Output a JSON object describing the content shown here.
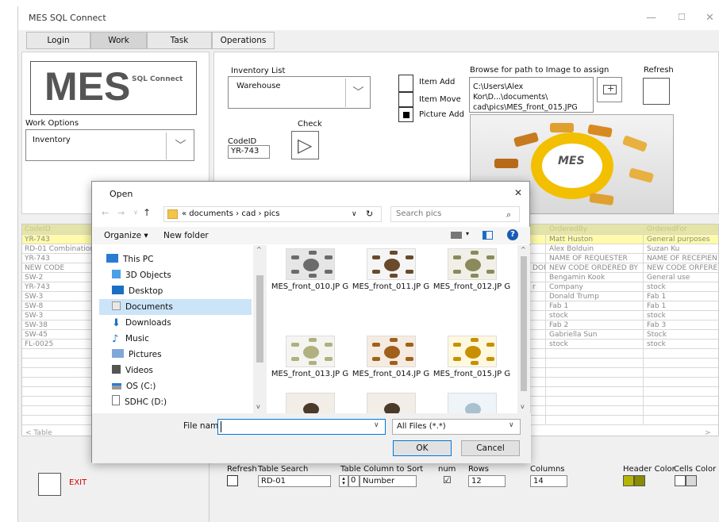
{
  "app": {
    "title": "MES SQL Connect",
    "minimize": "—",
    "maximize": "☐",
    "close": "✕"
  },
  "tabs": [
    {
      "label": "Login"
    },
    {
      "label": "Work"
    },
    {
      "label": "Task"
    },
    {
      "label": "Operations"
    }
  ],
  "logo": {
    "big": "MES",
    "small": "SQL Connect"
  },
  "work_options": {
    "label": "Work Options",
    "value": "Inventory"
  },
  "inventory": {
    "label": "Inventory List",
    "value": "Warehouse",
    "item_add": "Item Add",
    "item_move": "Item Move",
    "picture_add": "Picture Add",
    "check": "Check",
    "codeid_label": "CodeID",
    "codeid_value": "YR-743"
  },
  "browse": {
    "label": "Browse for path to Image to assign",
    "path": "C:\\Users\\Alex Kor\\D...\\documents\\ cad\\pics\\MES_front_015.JPG",
    "refresh": "Refresh",
    "image_center": "MES"
  },
  "grid": {
    "headers": [
      "CodeID",
      "OrderedBy",
      "OrderedFor"
    ],
    "rows": [
      {
        "code": "YR-743",
        "mid": "",
        "by": "Matt Huston",
        "for": "General purposes"
      },
      {
        "code": "RD-01 Combination",
        "mid": "",
        "by": "Alex Bolduin",
        "for": "Suzan Ku"
      },
      {
        "code": "YR-743",
        "mid": "",
        "by": "NAME OF REQUESTER",
        "for": "NAME OF RECEPIEN"
      },
      {
        "code": "NEW CODE",
        "mid": "DOR",
        "by": "NEW CODE ORDERED BY",
        "for": "NEW CODE ORFERE"
      },
      {
        "code": "SW-2",
        "mid": "",
        "by": "Bengamin Kook",
        "for": "General use"
      },
      {
        "code": "YR-743",
        "mid": "r",
        "by": "Company",
        "for": "stock"
      },
      {
        "code": "SW-3",
        "mid": "",
        "by": "Donald Trump",
        "for": "Fab 1"
      },
      {
        "code": "SW-8",
        "mid": "",
        "by": "Fab 1",
        "for": "Fab 1"
      },
      {
        "code": "SW-3",
        "mid": "",
        "by": "stock",
        "for": "stock"
      },
      {
        "code": "SW-38",
        "mid": "",
        "by": "Fab 2",
        "for": "Fab 3"
      },
      {
        "code": "SW-45",
        "mid": "",
        "by": "Gabriella Sun",
        "for": "Stock"
      },
      {
        "code": "FL-0025",
        "mid": "",
        "by": "stock",
        "for": "stock"
      }
    ],
    "caption": "Table",
    "scroll_left": "<",
    "scroll_right": ">"
  },
  "bottom": {
    "exit": "EXIT",
    "refresh": "Refresh",
    "table_search_label": "Table Search",
    "table_search_value": "RD-01",
    "sort_label": "Table Column to Sort",
    "sort_index": "0",
    "sort_value": "Number",
    "num_label": "num",
    "num_checked": "☑",
    "rows_label": "Rows",
    "rows_value": "12",
    "columns_label": "Columns",
    "columns_value": "14",
    "header_color_label": "Header Color",
    "cells_color_label": "Cells Color",
    "header_color": "#b5b500",
    "cells_color": "#d8d8d8"
  },
  "dialog": {
    "title": "Open",
    "close": "✕",
    "nav_back": "←",
    "nav_forward": "→",
    "nav_recent": "∨",
    "nav_up": "↑",
    "path": "« documents › cad › pics",
    "path_dropdown": "∨",
    "refresh": "↻",
    "search_placeholder": "Search pics",
    "organize": "Organize ▾",
    "new_folder": "New folder",
    "tree": [
      {
        "label": "This PC"
      },
      {
        "label": "3D Objects"
      },
      {
        "label": "Desktop"
      },
      {
        "label": "Documents"
      },
      {
        "label": "Downloads"
      },
      {
        "label": "Music"
      },
      {
        "label": "Pictures"
      },
      {
        "label": "Videos"
      },
      {
        "label": "OS (C:)"
      },
      {
        "label": "SDHC (D:)"
      }
    ],
    "files": [
      {
        "name": "MES_front_010.JP G"
      },
      {
        "name": "MES_front_011.JP G"
      },
      {
        "name": "MES_front_012.JP G"
      },
      {
        "name": "MES_front_013.JP G"
      },
      {
        "name": "MES_front_014.JP G"
      },
      {
        "name": "MES_front_015.JP G"
      }
    ],
    "filename_label": "File name:",
    "filename_value": "",
    "filter": "All Files (*.*)",
    "ok": "OK",
    "cancel": "Cancel"
  }
}
